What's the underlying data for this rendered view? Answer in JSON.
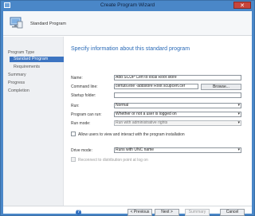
{
  "window": {
    "title": "Create Program Wizard",
    "close_label": "✕"
  },
  "banner": {
    "title": "Standard Program"
  },
  "nav": {
    "items": [
      {
        "label": "Program Type"
      },
      {
        "label": "Standard Program"
      },
      {
        "label": "Requirements"
      },
      {
        "label": "Summary"
      },
      {
        "label": "Progress"
      },
      {
        "label": "Completion"
      }
    ]
  },
  "main": {
    "heading": "Specify information about this standard program",
    "name": {
      "label": "Name:",
      "value": "Add SCUP Cert to local Root store"
    },
    "command_line": {
      "label": "Command line:",
      "value": "certutil.exe -addstore Root scupcert.cer"
    },
    "browse_label": "Browse...",
    "startup_folder": {
      "label": "Startup folder:",
      "value": ""
    },
    "run": {
      "label": "Run:",
      "value": "Normal"
    },
    "program_can_run": {
      "label": "Program can run:",
      "value": "Whether or not a user is logged on"
    },
    "run_mode": {
      "label": "Run mode:",
      "value": "Run with administrative rights"
    },
    "allow_interact": {
      "label": "Allow users to view and interact with the program installation"
    },
    "drive_mode": {
      "label": "Drive mode:",
      "value": "Runs with UNC name"
    },
    "reconnect": {
      "label": "Reconnect to distribution point at log on"
    }
  },
  "footer": {
    "help_label": "?",
    "previous": "< Previous",
    "next": "Next >",
    "summary": "Summary",
    "cancel": "Cancel"
  }
}
